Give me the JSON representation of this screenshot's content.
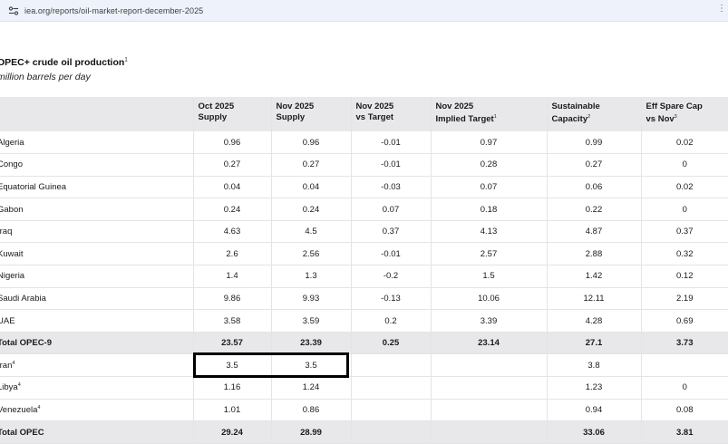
{
  "browser": {
    "url": "iea.org/reports/oil-market-report-december-2025",
    "site_icon": "tune-icon",
    "menu_icon": "more-icon"
  },
  "table_title": {
    "text": "OPEC+ crude oil production",
    "footnote": "1"
  },
  "units": "million barrels per day",
  "columns": [
    {
      "line1": "",
      "line2": "",
      "sup": ""
    },
    {
      "line1": "Oct 2025",
      "line2": "Supply",
      "sup": ""
    },
    {
      "line1": "Nov 2025",
      "line2": "Supply",
      "sup": ""
    },
    {
      "line1": "Nov 2025",
      "line2": "vs Target",
      "sup": ""
    },
    {
      "line1": "Nov 2025",
      "line2": "Implied Target",
      "sup": "1"
    },
    {
      "line1": "Sustainable",
      "line2": "Capacity",
      "sup": "2"
    },
    {
      "line1": "Eff Spare Cap",
      "line2": "vs Nov",
      "sup": "3"
    }
  ],
  "rows": [
    {
      "name": "Algeria",
      "sup": "",
      "oct": "0.96",
      "nov": "0.96",
      "vs_target": "-0.01",
      "target": "0.97",
      "capacity": "0.99",
      "spare": "0.02",
      "total": false
    },
    {
      "name": "Congo",
      "sup": "",
      "oct": "0.27",
      "nov": "0.27",
      "vs_target": "-0.01",
      "target": "0.28",
      "capacity": "0.27",
      "spare": "0",
      "total": false
    },
    {
      "name": "Equatorial Guinea",
      "sup": "",
      "oct": "0.04",
      "nov": "0.04",
      "vs_target": "-0.03",
      "target": "0.07",
      "capacity": "0.06",
      "spare": "0.02",
      "total": false
    },
    {
      "name": "Gabon",
      "sup": "",
      "oct": "0.24",
      "nov": "0.24",
      "vs_target": "0.07",
      "target": "0.18",
      "capacity": "0.22",
      "spare": "0",
      "total": false
    },
    {
      "name": "Iraq",
      "sup": "",
      "oct": "4.63",
      "nov": "4.5",
      "vs_target": "0.37",
      "target": "4.13",
      "capacity": "4.87",
      "spare": "0.37",
      "total": false
    },
    {
      "name": "Kuwait",
      "sup": "",
      "oct": "2.6",
      "nov": "2.56",
      "vs_target": "-0.01",
      "target": "2.57",
      "capacity": "2.88",
      "spare": "0.32",
      "total": false
    },
    {
      "name": "Nigeria",
      "sup": "",
      "oct": "1.4",
      "nov": "1.3",
      "vs_target": "-0.2",
      "target": "1.5",
      "capacity": "1.42",
      "spare": "0.12",
      "total": false
    },
    {
      "name": "Saudi Arabia",
      "sup": "",
      "oct": "9.86",
      "nov": "9.93",
      "vs_target": "-0.13",
      "target": "10.06",
      "capacity": "12.11",
      "spare": "2.19",
      "total": false
    },
    {
      "name": "UAE",
      "sup": "",
      "oct": "3.58",
      "nov": "3.59",
      "vs_target": "0.2",
      "target": "3.39",
      "capacity": "4.28",
      "spare": "0.69",
      "total": false
    },
    {
      "name": "Total OPEC-9",
      "sup": "",
      "oct": "23.57",
      "nov": "23.39",
      "vs_target": "0.25",
      "target": "23.14",
      "capacity": "27.1",
      "spare": "3.73",
      "total": true
    },
    {
      "name": "Iran",
      "sup": "4",
      "oct": "3.5",
      "nov": "3.5",
      "vs_target": "",
      "target": "",
      "capacity": "3.8",
      "spare": "",
      "total": false
    },
    {
      "name": "Libya",
      "sup": "4",
      "oct": "1.16",
      "nov": "1.24",
      "vs_target": "",
      "target": "",
      "capacity": "1.23",
      "spare": "0",
      "total": false
    },
    {
      "name": "Venezuela",
      "sup": "4",
      "oct": "1.01",
      "nov": "0.86",
      "vs_target": "",
      "target": "",
      "capacity": "0.94",
      "spare": "0.08",
      "total": false
    },
    {
      "name": "Total OPEC",
      "sup": "",
      "oct": "29.24",
      "nov": "28.99",
      "vs_target": "",
      "target": "",
      "capacity": "33.06",
      "spare": "3.81",
      "total": true
    }
  ],
  "highlight": {
    "row": "Iran",
    "columns": [
      "Oct 2025 Supply",
      "Nov 2025 Supply"
    ]
  }
}
